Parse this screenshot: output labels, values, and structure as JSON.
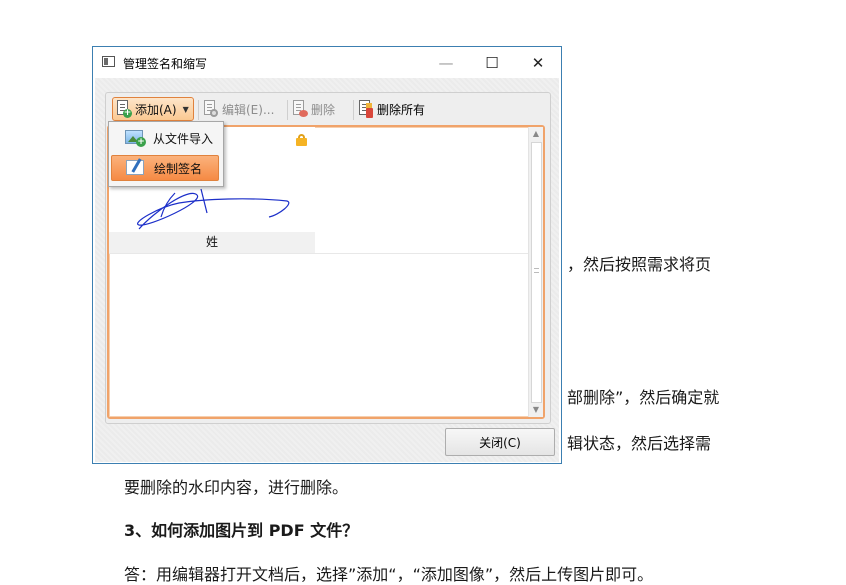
{
  "document": {
    "line1": "，然后按照需求将页",
    "line2": "部删除”，然后确定就",
    "line3": "辑状态，然后选择需",
    "line4": "要删除的水印内容，进行删除。",
    "heading": "3、如何添加图片到  PDF  文件？",
    "line5": "答：用编辑器打开文档后，选择”添加“，“添加图像”，然后上传图片即可。"
  },
  "dialog": {
    "title": "管理签名和缩写",
    "window_controls": {
      "minimize": "—",
      "maximize": "☐",
      "close": "✕"
    },
    "toolbar": {
      "add_label": "添加(A)",
      "edit_label": "编辑(E)...",
      "delete_label": "删除",
      "delete_all_label": "删除所有"
    },
    "menu": {
      "import_label": "从文件导入",
      "draw_label": "绘制签名"
    },
    "signatures": [
      {
        "caption": "姓"
      }
    ],
    "close_label": "关闭(C)"
  },
  "colors": {
    "accent_orange": "#f58a44",
    "window_border": "#3c7fb1",
    "signature_ink": "#1c2fc9"
  }
}
